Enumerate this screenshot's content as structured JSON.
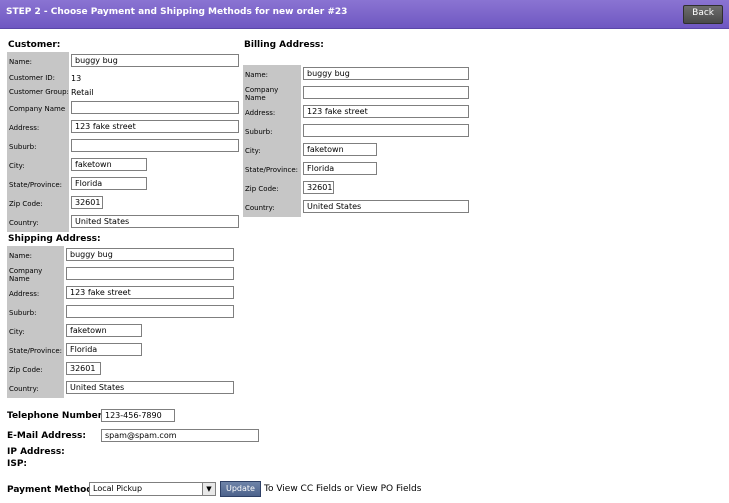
{
  "header": {
    "title": "STEP 2 - Choose Payment and Shipping Methods for new order #23",
    "back_label": "Back"
  },
  "customer": {
    "title": "Customer:",
    "name_label": "Name:",
    "name": "buggy bug",
    "id_label": "Customer ID:",
    "id": "13",
    "group_label": "Customer Group:",
    "group": "Retail",
    "company_label": "Company Name",
    "company": "",
    "address_label": "Address:",
    "address": "123 fake street",
    "suburb_label": "Suburb:",
    "suburb": "",
    "city_label": "City:",
    "city": "faketown",
    "state_label": "State/Province:",
    "state": "Florida",
    "zip_label": "Zip Code:",
    "zip": "32601",
    "country_label": "Country:",
    "country": "United States"
  },
  "billing": {
    "title": "Billing Address:",
    "name_label": "Name:",
    "name": "buggy bug",
    "company_label": "Company Name",
    "company": "",
    "address_label": "Address:",
    "address": "123 fake street",
    "suburb_label": "Suburb:",
    "suburb": "",
    "city_label": "City:",
    "city": "faketown",
    "state_label": "State/Province:",
    "state": "Florida",
    "zip_label": "Zip Code:",
    "zip": "32601",
    "country_label": "Country:",
    "country": "United States"
  },
  "shipping": {
    "title": "Shipping Address:",
    "name_label": "Name:",
    "name": "buggy bug",
    "company_label": "Company Name",
    "company": "",
    "address_label": "Address:",
    "address": "123 fake street",
    "suburb_label": "Suburb:",
    "suburb": "",
    "city_label": "City:",
    "city": "faketown",
    "state_label": "State/Province:",
    "state": "Florida",
    "zip_label": "Zip Code:",
    "zip": "32601",
    "country_label": "Country:",
    "country": "United States"
  },
  "contact": {
    "phone_label": "Telephone Number:",
    "phone": "123-456-7890",
    "email_label": "E-Mail Address:",
    "email": "spam@spam.com",
    "ip_label": "IP Address:",
    "isp_label": "ISP:"
  },
  "payment": {
    "label": "Payment Method:",
    "selected": "Local Pickup",
    "update_label": "Update",
    "hint": "To View CC Fields or View PO Fields"
  },
  "colors": {
    "header": "#7560c6",
    "label_bg": "#c6c6c6"
  },
  "icons": {
    "select_arrow": "chevron-down-icon"
  }
}
